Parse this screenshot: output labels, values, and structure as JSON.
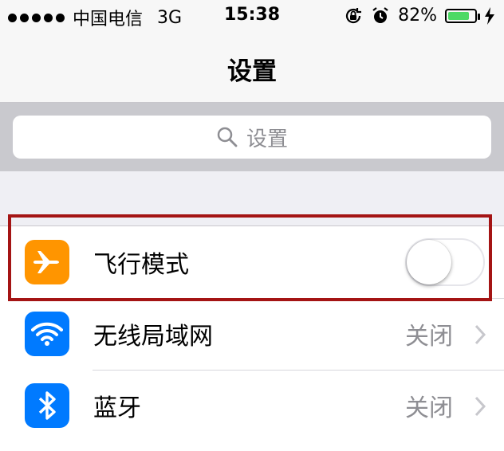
{
  "status_bar": {
    "carrier": "中国电信",
    "network": "3G",
    "time": "15:38",
    "battery_percent": "82%",
    "battery_level": 0.82,
    "icons": [
      "rotation-lock-icon",
      "alarm-icon",
      "charging-icon"
    ]
  },
  "nav": {
    "title": "设置"
  },
  "search": {
    "placeholder": "设置"
  },
  "settings": [
    {
      "label": "飞行模式",
      "icon": "airplane-icon",
      "color": "#ff9500",
      "toggle_on": false
    },
    {
      "label": "无线局域网",
      "icon": "wifi-icon",
      "color": "#007aff",
      "value": "关闭"
    },
    {
      "label": "蓝牙",
      "icon": "bluetooth-icon",
      "color": "#007aff",
      "value": "关闭"
    }
  ],
  "colors": {
    "highlight": "#a41414",
    "battery": "#4cd964"
  }
}
